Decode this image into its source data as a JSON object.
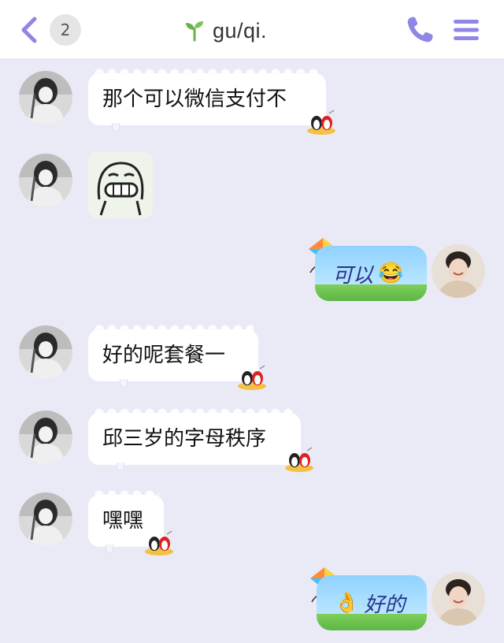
{
  "header": {
    "back_icon": "chevron-left-icon",
    "unread_count": "2",
    "title_icon": "sprout-icon",
    "title": "gu/qi.",
    "call_icon": "phone-icon",
    "menu_icon": "menu-icon",
    "accent_color": "#8f86e6"
  },
  "messages": [
    {
      "side": "left",
      "text": "那个可以微信支付不"
    },
    {
      "side": "left",
      "sticker": "grinning-face-sticker"
    },
    {
      "side": "right",
      "text": "可以",
      "emoji": "😂"
    },
    {
      "side": "left",
      "text": "好的呢套餐一"
    },
    {
      "side": "left",
      "text": "邱三岁的字母秩序"
    },
    {
      "side": "left",
      "text": "嘿嘿"
    },
    {
      "side": "right",
      "emoji": "👌",
      "text": "好的"
    }
  ],
  "colors": {
    "background": "#e9eaf6",
    "header_bg": "#ffffff",
    "bubble_left": "#ffffff",
    "bubble_right_sky": "#a9dcff",
    "bubble_right_grass": "#6cc04f"
  }
}
